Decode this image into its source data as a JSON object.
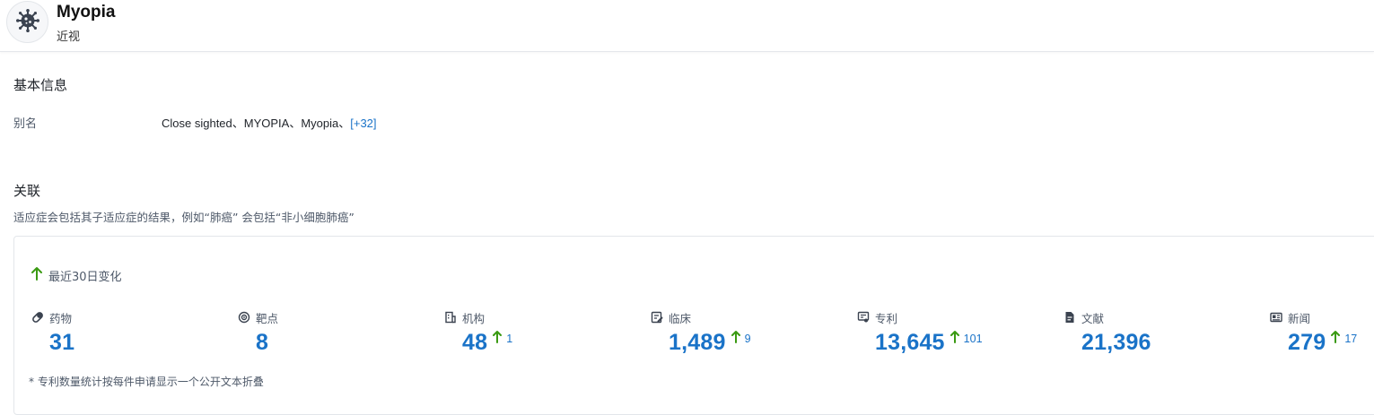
{
  "header": {
    "title": "Myopia",
    "subtitle": "近视",
    "icon": "virus-icon"
  },
  "basic_info": {
    "heading": "基本信息",
    "alias_label": "别名",
    "alias_value": "Close sighted、MYOPIA、Myopia、",
    "alias_more": "[+32]"
  },
  "association": {
    "heading": "关联",
    "description": "适应症会包括其子适应症的结果，例如“肺癌” 会包括“非小细胞肺癌”",
    "recent_label": "最近30日变化",
    "footnote": "* 专利数量统计按每件申请显示一个公开文本折叠",
    "stats": [
      {
        "label": "药物",
        "value": "31",
        "delta": "",
        "icon": "pill-icon"
      },
      {
        "label": "靶点",
        "value": "8",
        "delta": "",
        "icon": "target-icon"
      },
      {
        "label": "机构",
        "value": "48",
        "delta": "1",
        "icon": "building-icon"
      },
      {
        "label": "临床",
        "value": "1,489",
        "delta": "9",
        "icon": "clinical-icon"
      },
      {
        "label": "专利",
        "value": "13,645",
        "delta": "101",
        "icon": "patent-icon"
      },
      {
        "label": "文献",
        "value": "21,396",
        "delta": "",
        "icon": "document-icon"
      },
      {
        "label": "新闻",
        "value": "279",
        "delta": "17",
        "icon": "news-icon"
      }
    ]
  },
  "colors": {
    "accent": "#1a73c8",
    "up_arrow": "#3a9a12",
    "muted_text": "#4e5969"
  }
}
